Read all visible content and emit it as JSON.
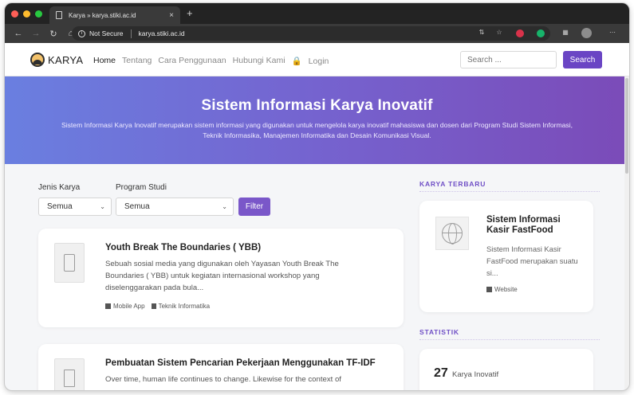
{
  "browser": {
    "tab_title": "Karya » karya.stiki.ac.id",
    "tab_close": "×",
    "new_tab": "+",
    "security": "Not Secure",
    "url": "karya.stiki.ac.id"
  },
  "nav": {
    "brand": "KARYA",
    "items": [
      {
        "label": "Home"
      },
      {
        "label": "Tentang"
      },
      {
        "label": "Cara Penggunaan"
      },
      {
        "label": "Hubungi Kami"
      },
      {
        "label": "Login"
      }
    ],
    "search_placeholder": "Search ...",
    "search_button": "Search"
  },
  "hero": {
    "title": "Sistem Informasi Karya Inovatif",
    "subtitle": "Sistem Informasi Karya Inovatif merupakan sistem informasi yang digunakan untuk mengelola karya inovatif mahasiswa dan dosen dari Program Studi Sistem Informasi, Teknik Informasika, Manajemen Informatika dan Desain Komunikasi Visual."
  },
  "filter": {
    "jenis_label": "Jenis Karya",
    "jenis_value": "Semua",
    "prodi_label": "Program Studi",
    "prodi_value": "Semua",
    "button": "Filter"
  },
  "cards": [
    {
      "title": "Youth Break The Boundaries ( YBB)",
      "desc": "Sebuah sosial media yang digunakan oleh Yayasan Youth Break The Boundaries ( YBB) untuk kegiatan internasional workshop yang diselenggarakan pada bula...",
      "type": "Mobile App",
      "prodi": "Teknik Informatika"
    },
    {
      "title": "Pembuatan Sistem Pencarian Pekerjaan Menggunakan TF-IDF",
      "desc": "Over time, human life continues to change. Likewise for the context of"
    }
  ],
  "sidebar": {
    "latest_heading": "KARYA TERBARU",
    "latest": {
      "title": "Sistem Informasi Kasir FastFood",
      "desc": "Sistem Informasi Kasir FastFood merupakan suatu si...",
      "type": "Website"
    },
    "stats_heading": "STATISTIK",
    "stat_value": "27",
    "stat_label": "Karya Inovatif"
  }
}
